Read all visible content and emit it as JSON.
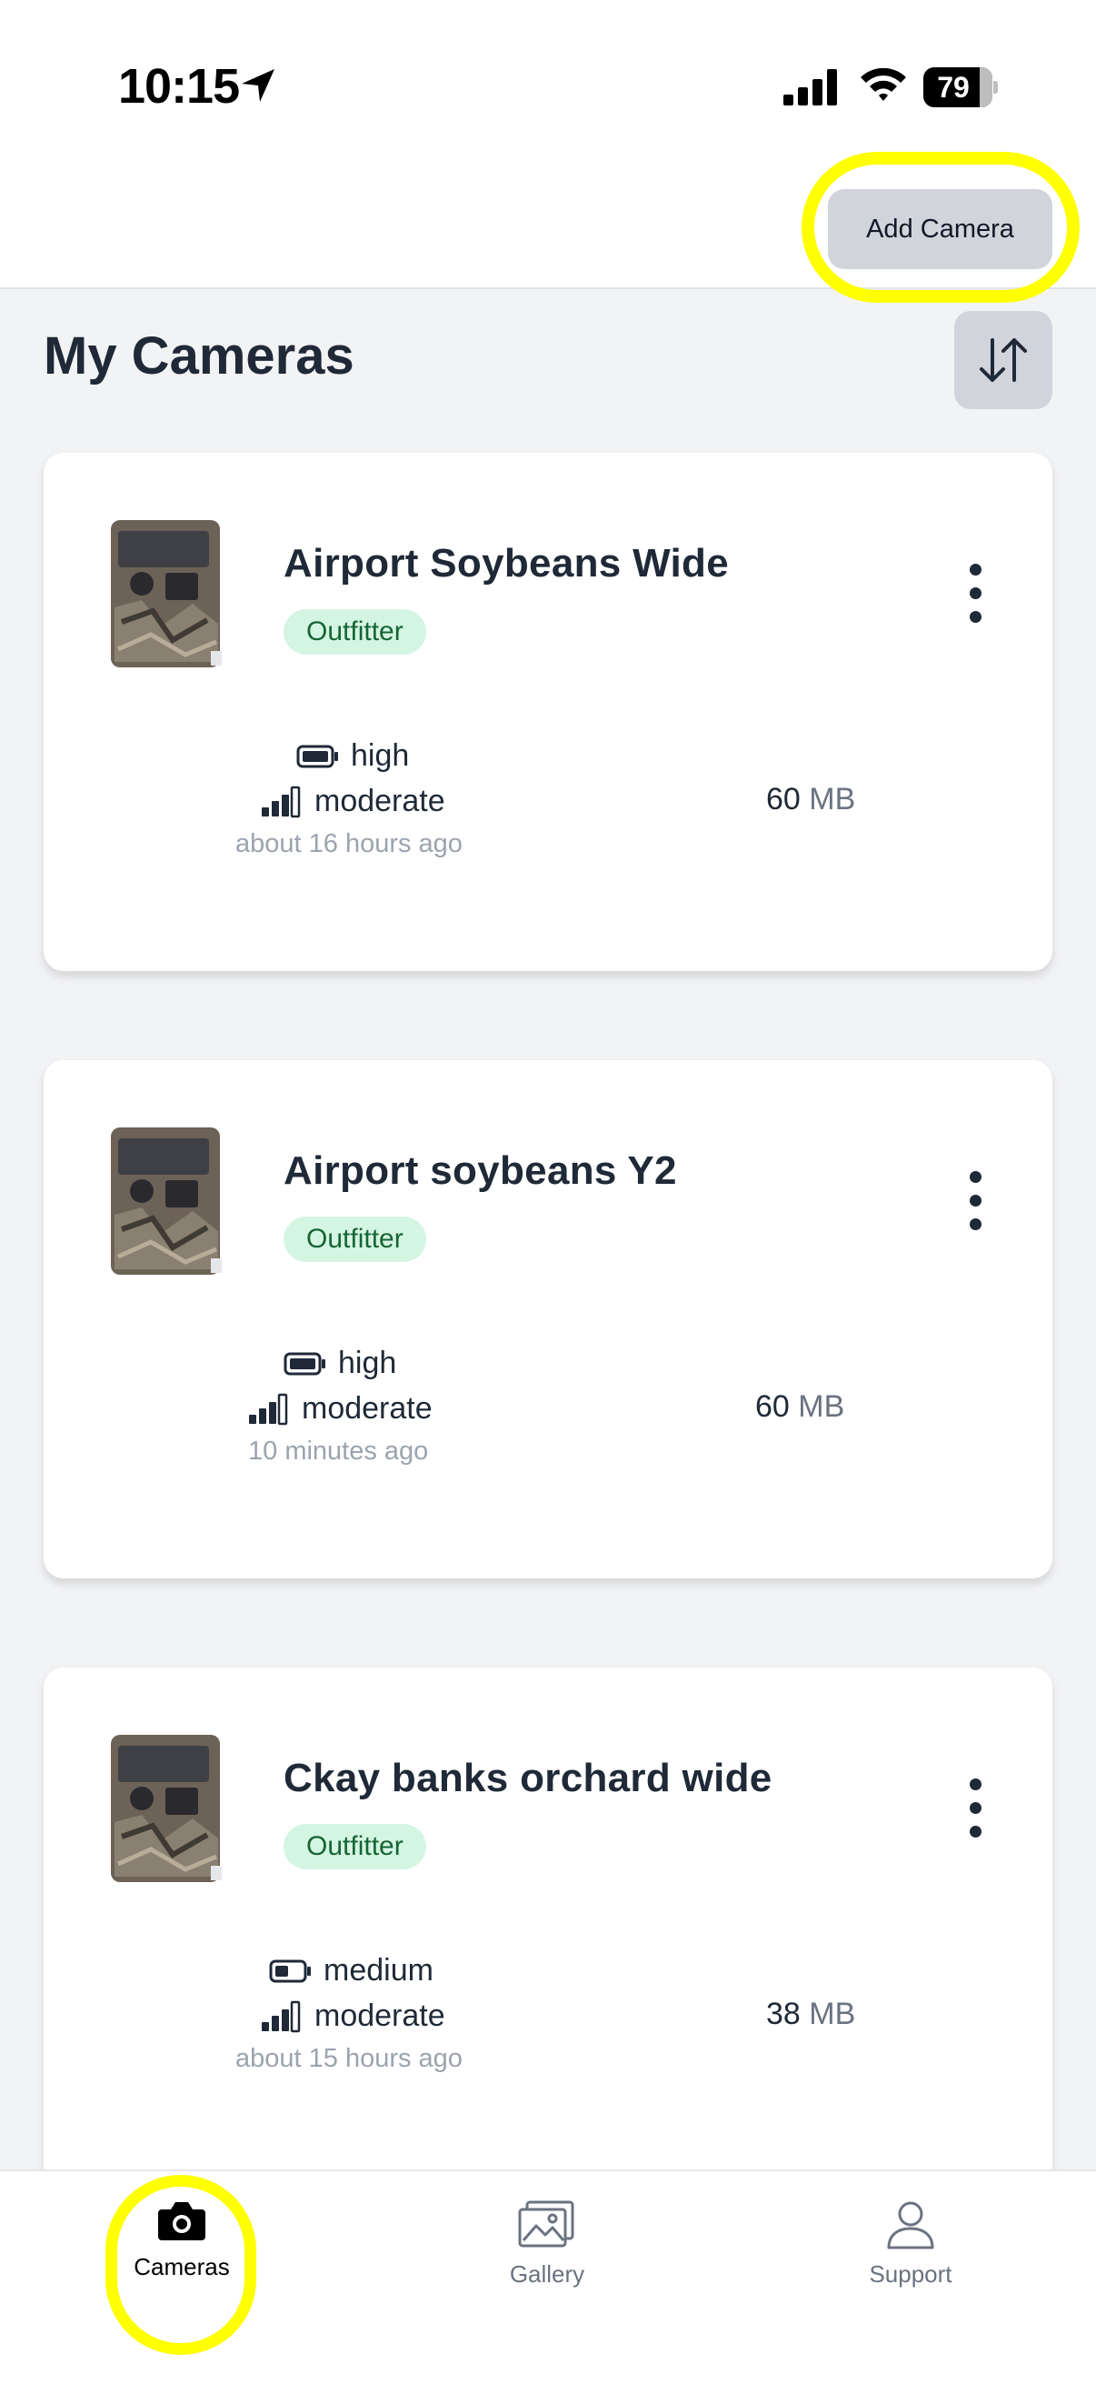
{
  "status_bar": {
    "time": "10:15",
    "battery": "79"
  },
  "header": {
    "add_camera_label": "Add Camera"
  },
  "section": {
    "title": "My Cameras"
  },
  "cameras": [
    {
      "name": "Airport Soybeans Wide",
      "badge": "Outfitter",
      "battery": "high",
      "signal": "moderate",
      "updated": "about 16 hours ago",
      "storage_value": "60",
      "storage_unit": "MB",
      "battery_level": 1.0
    },
    {
      "name": "Airport soybeans Y2",
      "badge": "Outfitter",
      "battery": "high",
      "signal": "moderate",
      "updated": "10 minutes ago",
      "storage_value": "60",
      "storage_unit": "MB",
      "battery_level": 1.0
    },
    {
      "name": "Ckay banks orchard wide",
      "badge": "Outfitter",
      "battery": "medium",
      "signal": "moderate",
      "updated": "about 15 hours ago",
      "storage_value": "38",
      "storage_unit": "MB",
      "battery_level": 0.5
    }
  ],
  "tabs": [
    {
      "label": "Cameras",
      "icon": "camera-icon",
      "active": true
    },
    {
      "label": "Gallery",
      "icon": "gallery-icon",
      "active": false
    },
    {
      "label": "Support",
      "icon": "person-icon",
      "active": false
    }
  ],
  "colors": {
    "highlight": "#ffff00",
    "badge_bg": "#d5f5e3",
    "badge_text": "#166534",
    "button_bg": "#d1d5db"
  }
}
